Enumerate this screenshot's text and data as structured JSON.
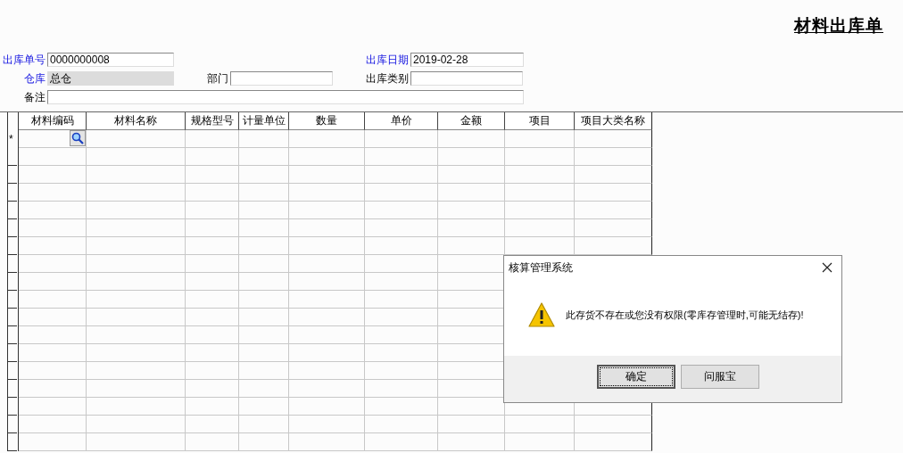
{
  "title": "材料出库单",
  "form_rows": [
    [
      {
        "label": "出库单号",
        "value": "0000000008",
        "required": true,
        "disabled": false
      },
      {
        "label": "出库日期",
        "value": "2019-02-28",
        "required": true,
        "disabled": false
      }
    ],
    [
      {
        "label": "仓库",
        "value": "总仓",
        "required": true,
        "disabled": true
      },
      {
        "label": "部门",
        "required": false,
        "disabled": false
      },
      {
        "label": "出库类别",
        "required": false,
        "disabled": false
      }
    ],
    [
      {
        "label": "备注",
        "required": false,
        "disabled": false
      }
    ]
  ],
  "table": {
    "columns": [
      "材料编码",
      "材料名称",
      "规格型号",
      "计量单位",
      "数量",
      "单价",
      "金额",
      "项目",
      "项目大类名称"
    ],
    "new_row_marker": "*"
  },
  "dialog": {
    "title": "核算管理系统",
    "message": "此存货不存在或您没有权限(零库存管理时,可能无结存)!",
    "buttons": [
      {
        "label": "确定",
        "focused": true
      },
      {
        "label": "问服宝",
        "focused": false
      }
    ]
  }
}
